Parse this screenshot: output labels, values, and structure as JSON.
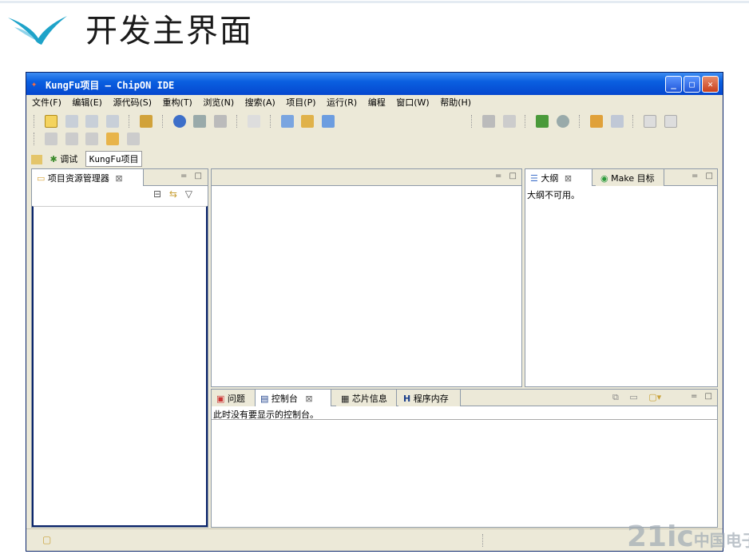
{
  "slide": {
    "title": "开发主界面"
  },
  "window": {
    "title": "KungFu项目 — ChipON IDE",
    "controls": {
      "minimize": "_",
      "maximize": "□",
      "close": "✕"
    }
  },
  "menu": [
    "文件(F)",
    "编辑(E)",
    "源代码(S)",
    "重构(T)",
    "浏览(N)",
    "搜索(A)",
    "项目(P)",
    "运行(R)",
    "编程",
    "窗口(W)",
    "帮助(H)"
  ],
  "perspectives": {
    "debug": "调试",
    "project": "KungFu项目"
  },
  "project_explorer": {
    "tab": "项目资源管理器",
    "close": "⊠"
  },
  "outline": {
    "tab": "大纲",
    "close": "⊠",
    "make_tab": "Make 目标",
    "message": "大纲不可用。"
  },
  "console": {
    "tabs": [
      "问题",
      "控制台",
      "芯片信息",
      "程序内存"
    ],
    "close": "⊠",
    "message": "此时没有要显示的控制台。"
  },
  "minmax": "= □",
  "watermark": {
    "main": "21ic",
    "sub": "中国电子网"
  },
  "colors": {
    "titlebar": "#0a5fe0",
    "frame": "#ece9d8",
    "border": "#8e9aa8"
  },
  "icons": [
    "logo-swallow-icon",
    "app-icon",
    "new-icon",
    "save-icon",
    "debug-icon",
    "run-icon",
    "search-icon",
    "back-icon",
    "forward-icon",
    "perspective-icon"
  ]
}
